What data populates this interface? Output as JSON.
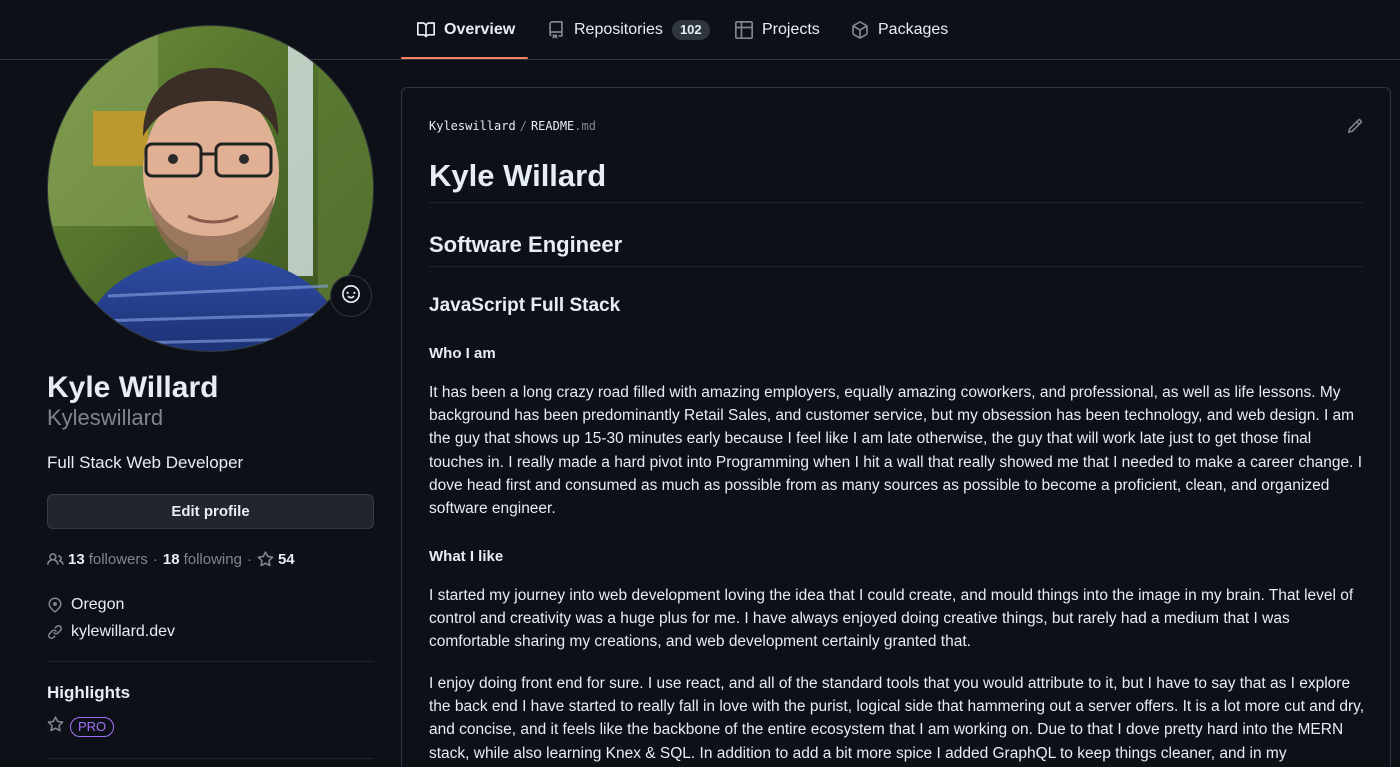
{
  "nav": {
    "tabs": [
      {
        "label": "Overview",
        "icon": "book-icon",
        "active": true
      },
      {
        "label": "Repositories",
        "icon": "repo-icon",
        "count": "102"
      },
      {
        "label": "Projects",
        "icon": "table-icon"
      },
      {
        "label": "Packages",
        "icon": "package-icon"
      }
    ]
  },
  "profile": {
    "full_name": "Kyle Willard",
    "username": "Kyleswillard",
    "bio": "Full Stack Web Developer",
    "edit_label": "Edit profile",
    "followers_count": "13",
    "followers_label": "followers",
    "following_count": "18",
    "following_label": "following",
    "separator": "·",
    "stars_count": "54",
    "location": "Oregon",
    "website": "kylewillard.dev",
    "highlights_title": "Highlights",
    "pro_badge": "PRO"
  },
  "readme": {
    "owner": "Kyleswillard",
    "path_sep": "/",
    "file": "README",
    "ext": ".md",
    "h1": "Kyle Willard",
    "h2": "Software Engineer",
    "h3": "JavaScript Full Stack",
    "who_heading": "Who I am",
    "who_text": "It has been a long crazy road filled with amazing employers, equally amazing coworkers, and professional, as well as life lessons. My background has been predominantly Retail Sales, and customer service, but my obsession has been technology, and web design. I am the guy that shows up 15-30 minutes early because I feel like I am late otherwise, the guy that will work late just to get those final touches in. I really made a hard pivot into Programming when I hit a wall that really showed me that I needed to make a career change. I dove head first and consumed as much as possible from as many sources as possible to become a proficient, clean, and organized software engineer.",
    "like_heading": "What I like",
    "like_text1": "I started my journey into web development loving the idea that I could create, and mould things into the image in my brain. That level of control and creativity was a huge plus for me. I have always enjoyed doing creative things, but rarely had a medium that I was comfortable sharing my creations, and web development certainly granted that.",
    "like_text2": "I enjoy doing front end for sure. I use react, and all of the standard tools that you would attribute to it, but I have to say that as I explore the back end I have started to really fall in love with the purist, logical side that hammering out a server offers. It is a lot more cut and dry, and concise, and it feels like the backbone of the entire ecosystem that I am working on. Due to that I dove pretty hard into the MERN stack, while also learning Knex & SQL. In addition to add a bit more spice I added GraphQL to keep things cleaner, and in my"
  },
  "colors": {
    "background": "#0d1117",
    "border": "#30363d",
    "muted": "#7d8590",
    "accent_underline": "#f78166",
    "pro": "#a371f7"
  }
}
